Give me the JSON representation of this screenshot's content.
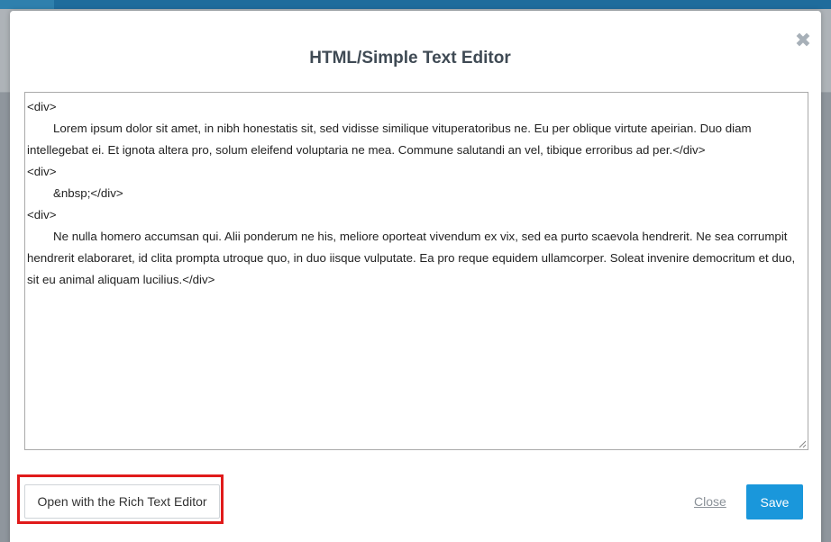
{
  "modal": {
    "title": "HTML/Simple Text Editor",
    "close_icon": "close-icon",
    "editor_lines": [
      {
        "text": "<div>",
        "indent": false
      },
      {
        "text": "Lorem ipsum dolor sit amet, in nibh honestatis sit, sed vidisse similique vituperatoribus ne. Eu per oblique virtute apeirian. Duo diam intellegebat ei. Et ignota altera pro, solum eleifend voluptaria ne mea. Commune salutandi an vel, tibique erroribus ad per.</div>",
        "indent": true
      },
      {
        "text": "<div>",
        "indent": false
      },
      {
        "text": "&nbsp;</div>",
        "indent": true
      },
      {
        "text": "<div>",
        "indent": false
      },
      {
        "text": "Ne nulla homero accumsan qui. Alii ponderum ne his, meliore oporteat vivendum ex vix, sed ea purto scaevola hendrerit. Ne sea corrumpit hendrerit elaboraret, id clita prompta utroque quo, in duo iisque vulputate. Ea pro reque equidem ullamcorper. Soleat invenire democritum et duo, sit eu animal aliquam lucilius.</div>",
        "indent": true
      }
    ],
    "footer": {
      "rich_text_button": "Open with the Rich Text Editor",
      "close_label": "Close",
      "save_label": "Save"
    }
  },
  "colors": {
    "save_button": "#1a97db",
    "highlight": "#e01a1a",
    "title": "#3f4a54"
  }
}
